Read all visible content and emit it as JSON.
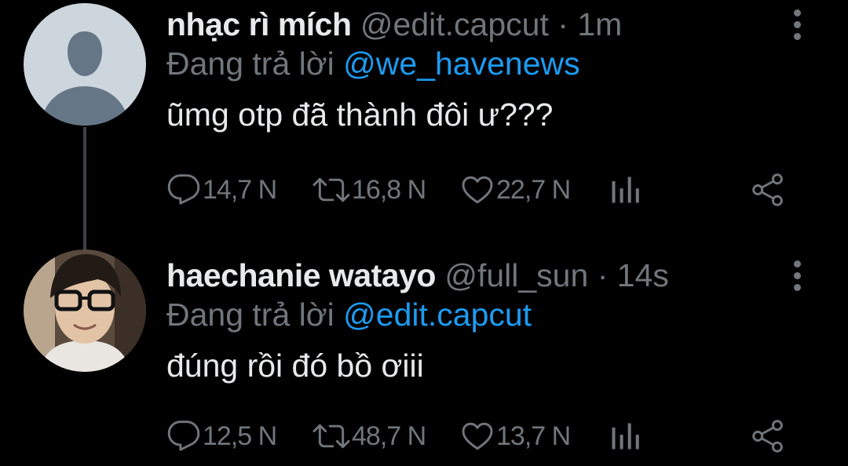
{
  "tweets": [
    {
      "display_name": "nhạc rì mích",
      "handle": "@edit.capcut",
      "separator": "·",
      "time": "1m",
      "replying_prefix": "Đang trả lời",
      "replying_to": "@we_havenews",
      "text": "ũmg otp đã thành đôi ư???",
      "avatar": "default-avatar",
      "replies": "14,7 N",
      "retweets": "16,8 N",
      "likes": "22,7 N"
    },
    {
      "display_name": "haechanie watayo",
      "handle": "@full_sun",
      "separator": "·",
      "time": "14s",
      "replying_prefix": "Đang trả lời",
      "replying_to": "@edit.capcut",
      "text": "đúng rồi đó bồ ơiii",
      "avatar": "photo-avatar",
      "replies": "12,5 N",
      "retweets": "48,7 N",
      "likes": "13,7 N"
    }
  ],
  "colors": {
    "background": "#000000",
    "primary_text": "#e7e9ea",
    "secondary_text": "#71767b",
    "link": "#1d9bf0",
    "thread_line": "#3e4144"
  },
  "icons": [
    "reply-icon",
    "retweet-icon",
    "like-icon",
    "views-icon",
    "share-icon",
    "more-icon"
  ]
}
